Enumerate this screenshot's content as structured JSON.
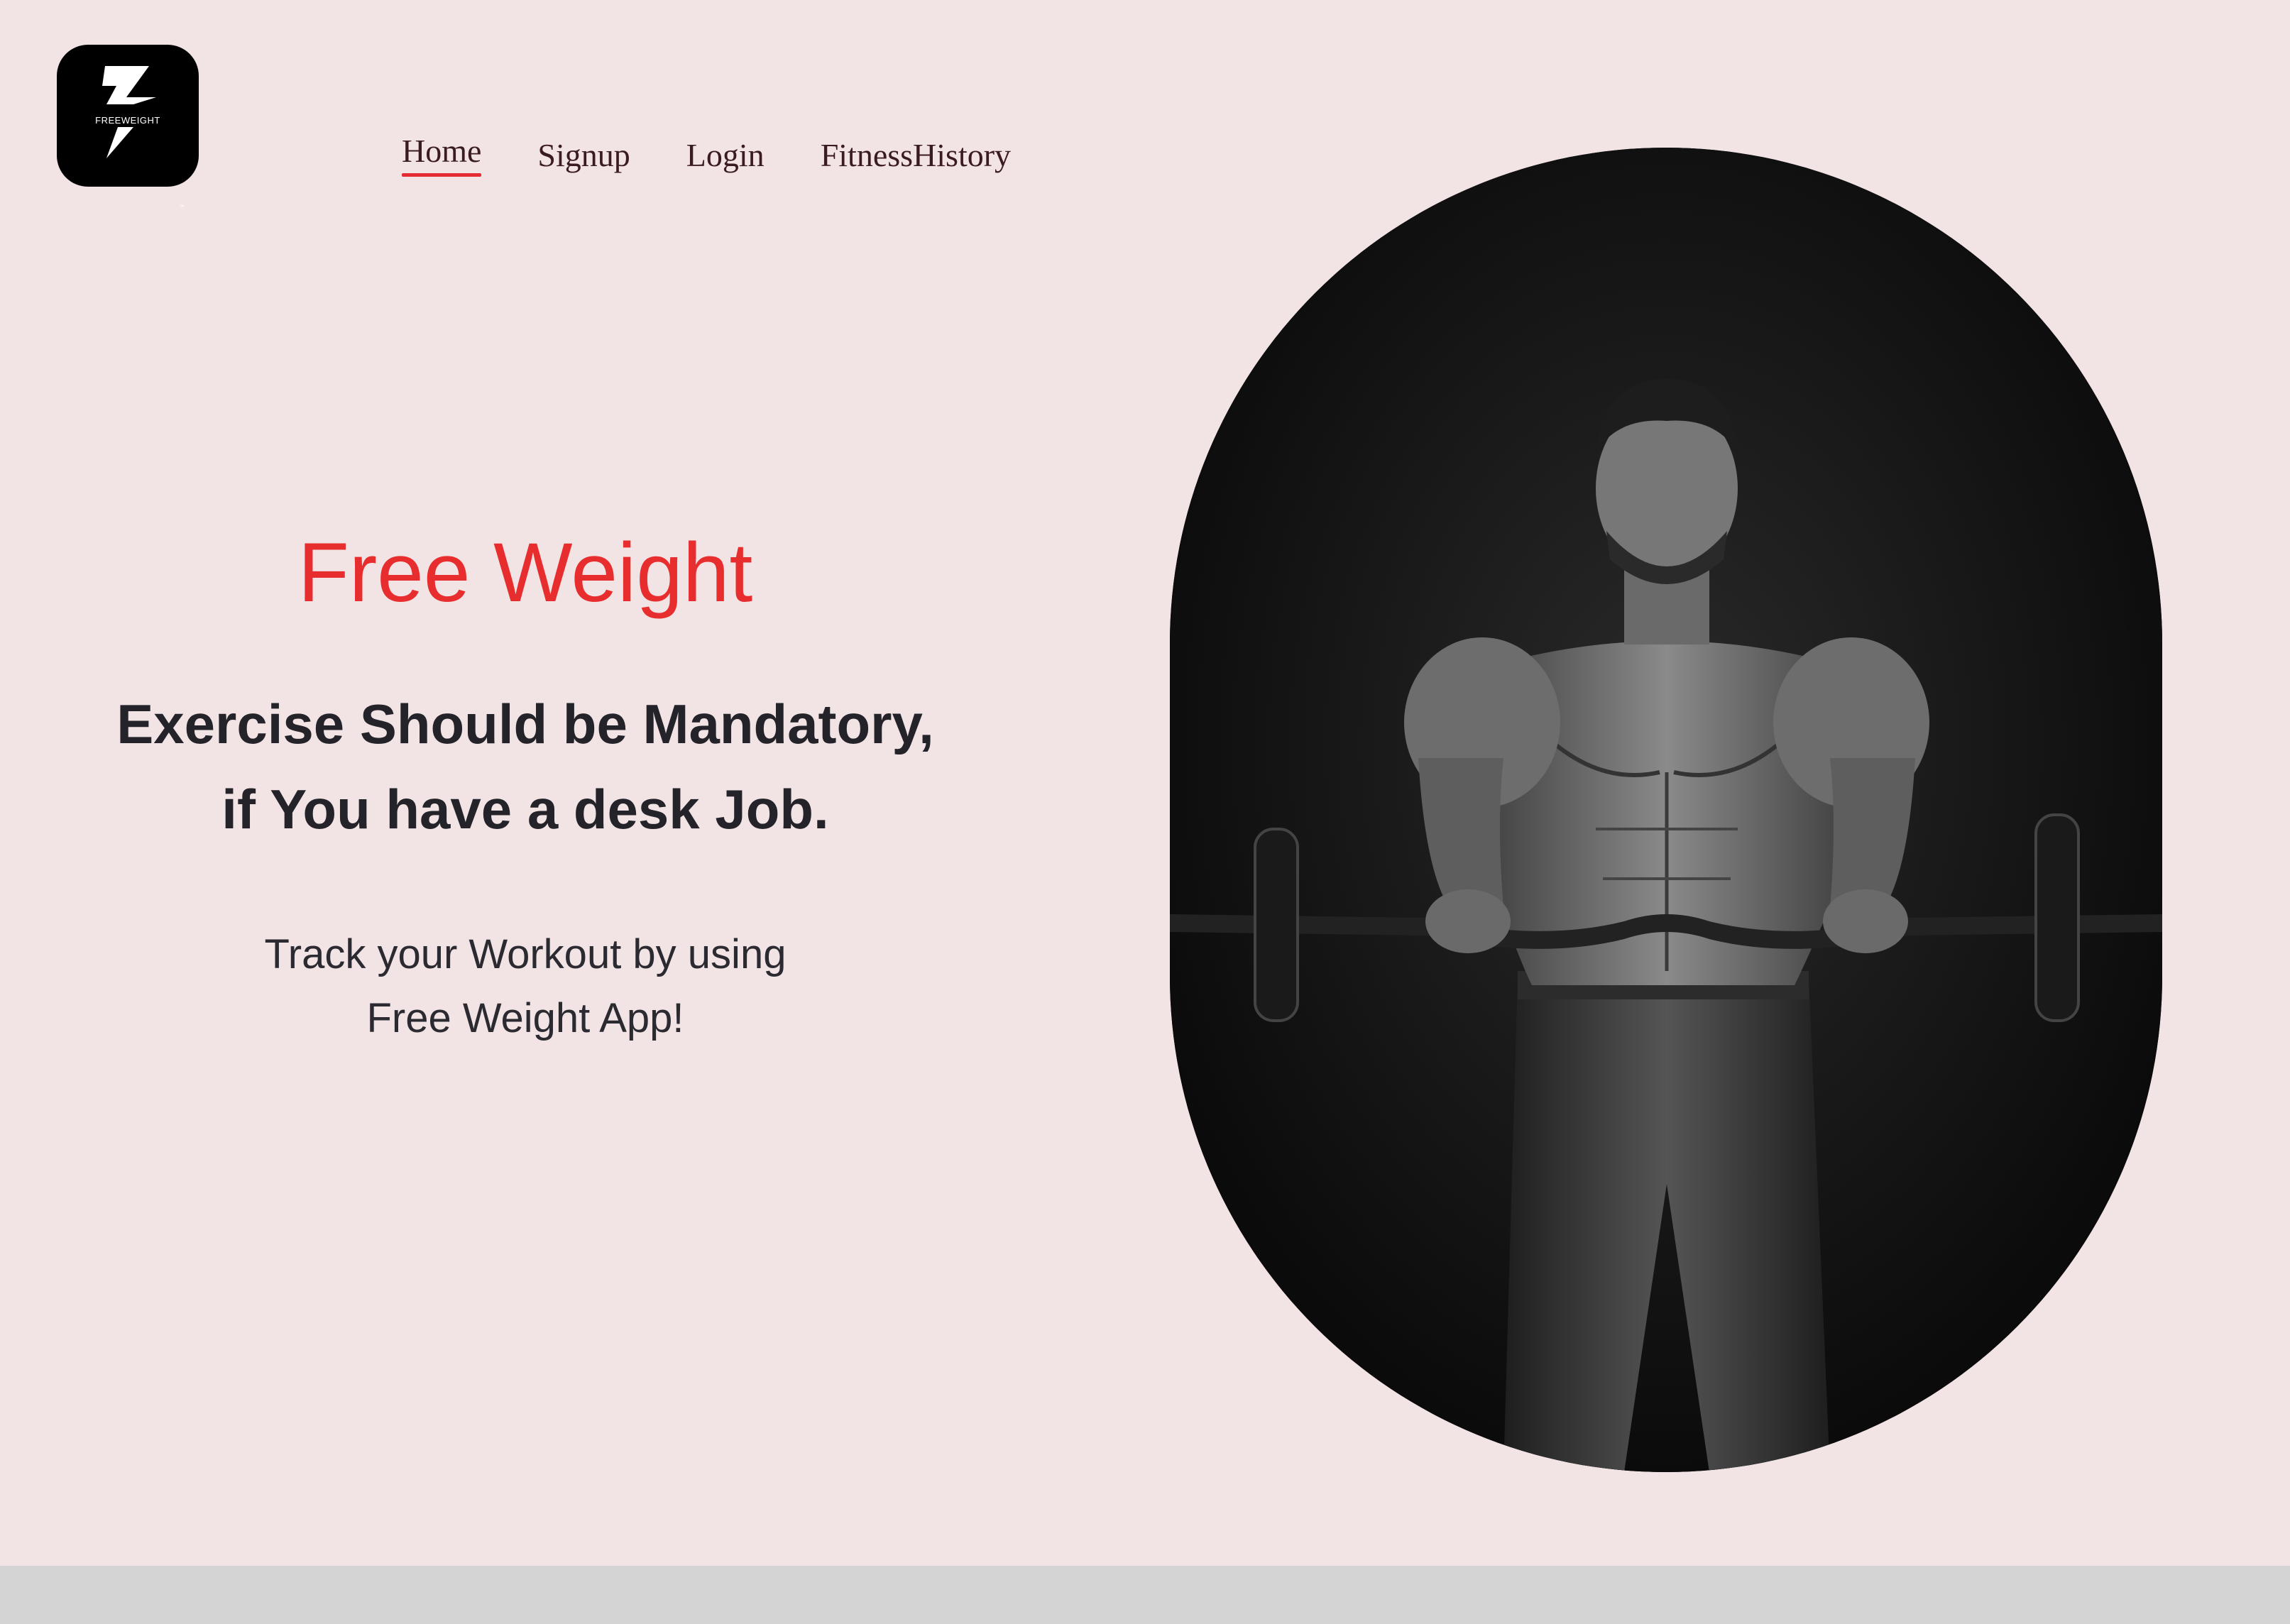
{
  "logo": {
    "text": "FREEWEIGHT",
    "tm": "™"
  },
  "nav": {
    "home": "Home",
    "signup": "Signup",
    "login": "Login",
    "fitness_history": "FitnessHistory"
  },
  "hero": {
    "title": "Free Weight",
    "headline_line1": "Exercise Should be Mandatory,",
    "headline_line2": "if You have a desk Job.",
    "sub_line1": "Track your Workout by using",
    "sub_line2": "Free Weight App!"
  },
  "colors": {
    "background": "#f2e3e4",
    "accent": "#e82d2e",
    "nav_text": "#3a1b20",
    "footer_bar": "#d4d4d4"
  }
}
